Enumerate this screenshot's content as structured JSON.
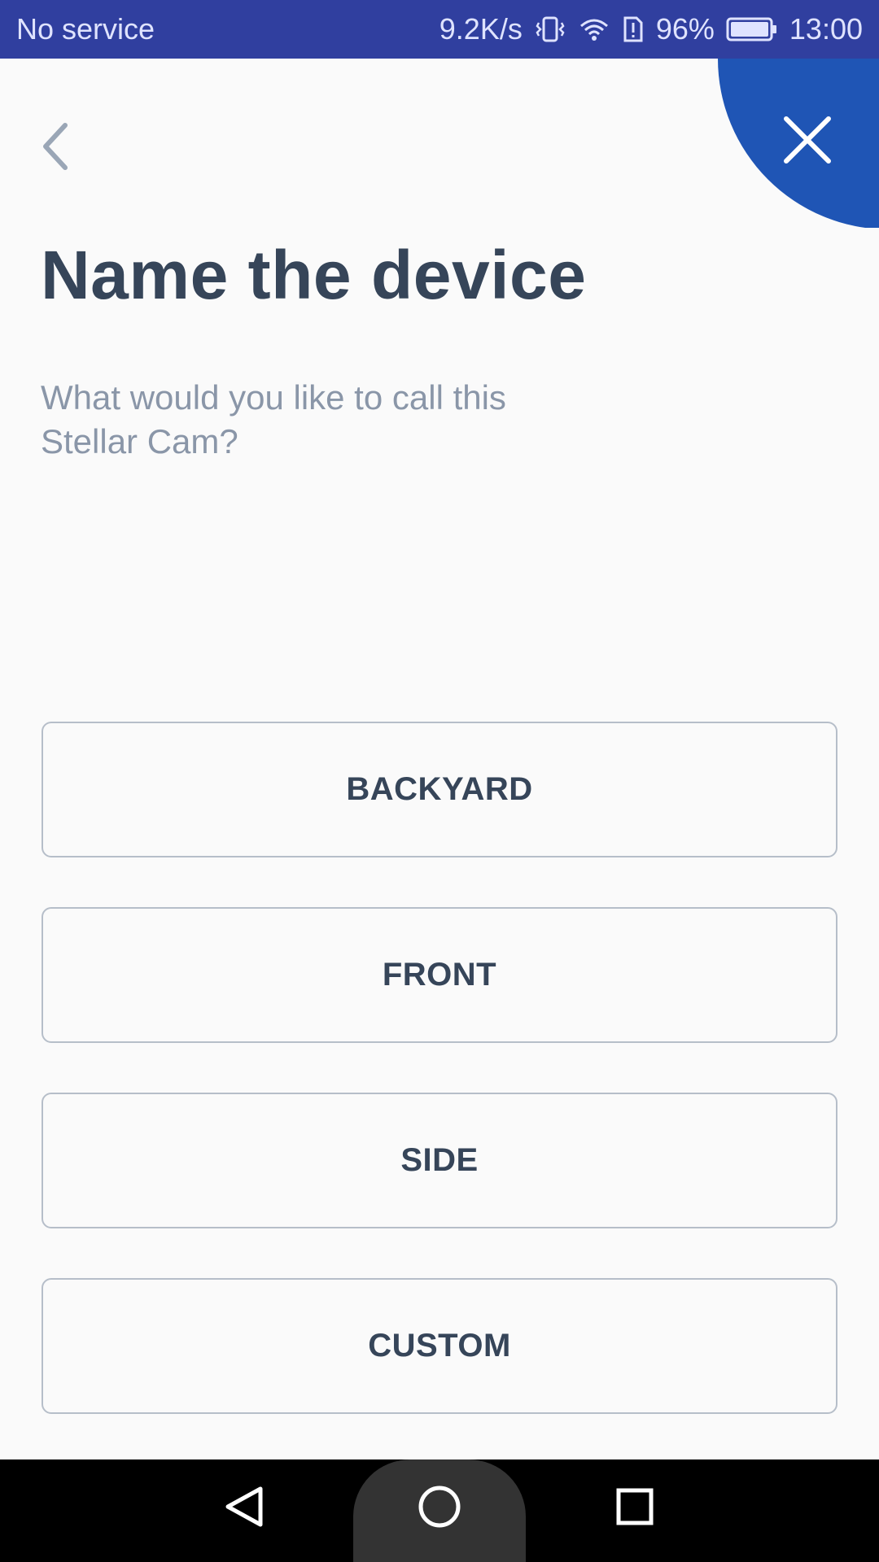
{
  "status_bar": {
    "carrier": "No service",
    "net_speed": "9.2K/s",
    "battery_pct": "96%",
    "time": "13:00",
    "bg_color": "#303f9f"
  },
  "header": {
    "back_icon": "chevron-left-icon",
    "close_icon": "close-icon",
    "accent_color": "#1f55b5"
  },
  "main": {
    "title": "Name the device",
    "subtitle": "What would you like to call this Stellar Cam?",
    "options": [
      {
        "label": "BACKYARD"
      },
      {
        "label": "FRONT"
      },
      {
        "label": "SIDE"
      },
      {
        "label": "CUSTOM"
      }
    ]
  },
  "nav_bar": {
    "back_icon": "triangle-back-icon",
    "home_icon": "circle-home-icon",
    "recents_icon": "square-recents-icon"
  }
}
